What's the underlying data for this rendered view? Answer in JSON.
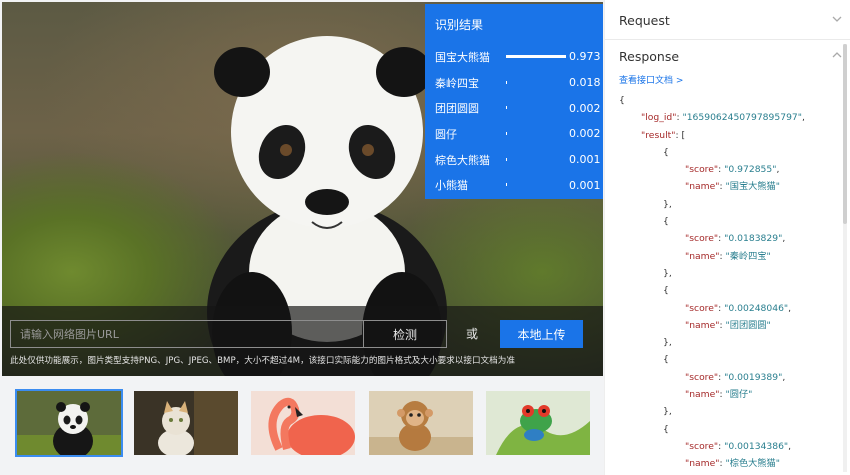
{
  "results": {
    "title": "识别结果",
    "items": [
      {
        "name": "国宝大熊猫",
        "score": "0.973",
        "value": 0.973
      },
      {
        "name": "秦岭四宝",
        "score": "0.018",
        "value": 0.018
      },
      {
        "name": "团团圆圆",
        "score": "0.002",
        "value": 0.002
      },
      {
        "name": "圆仔",
        "score": "0.002",
        "value": 0.002
      },
      {
        "name": "棕色大熊猫",
        "score": "0.001",
        "value": 0.001
      },
      {
        "name": "小熊猫",
        "score": "0.001",
        "value": 0.001
      }
    ]
  },
  "input": {
    "placeholder": "请输入网络图片URL",
    "detect_label": "检测",
    "or_label": "或",
    "upload_label": "本地上传",
    "hint": "此处仅供功能展示，图片类型支持PNG、JPG、JPEG、BMP，大小不超过4M，该接口实际能力的图片格式及大小要求以接口文档为准"
  },
  "thumbnails": [
    {
      "label": "panda",
      "selected": true
    },
    {
      "label": "cat",
      "selected": false
    },
    {
      "label": "flamingo",
      "selected": false
    },
    {
      "label": "monkey",
      "selected": false
    },
    {
      "label": "frog",
      "selected": false
    }
  ],
  "side": {
    "request_label": "Request",
    "response_label": "Response",
    "doc_link": "查看接口文档 >",
    "json": {
      "open_brace": "{",
      "log_id_key": "\"log_id\"",
      "log_id_value": "\"1659062450797895797\"",
      "result_key": "\"result\"",
      "result_open": ": [",
      "obj_open": "{",
      "obj_close": "},",
      "score_key": "\"score\"",
      "name_key": "\"name\"",
      "entries": [
        {
          "score": "\"0.972855\"",
          "name": "\"国宝大熊猫\""
        },
        {
          "score": "\"0.0183829\"",
          "name": "\"秦岭四宝\""
        },
        {
          "score": "\"0.00248046\"",
          "name": "\"团团圆圆\""
        },
        {
          "score": "\"0.0019389\"",
          "name": "\"圆仔\""
        },
        {
          "score": "\"0.00134386\"",
          "name": "\"棕色大熊猫\""
        }
      ]
    }
  },
  "colors": {
    "accent": "#1a74e8",
    "json_key": "#a52a2a",
    "json_string": "#2a7f8f"
  },
  "icons": {
    "request_toggle": "chevron-down-icon",
    "response_toggle": "chevron-up-icon"
  }
}
